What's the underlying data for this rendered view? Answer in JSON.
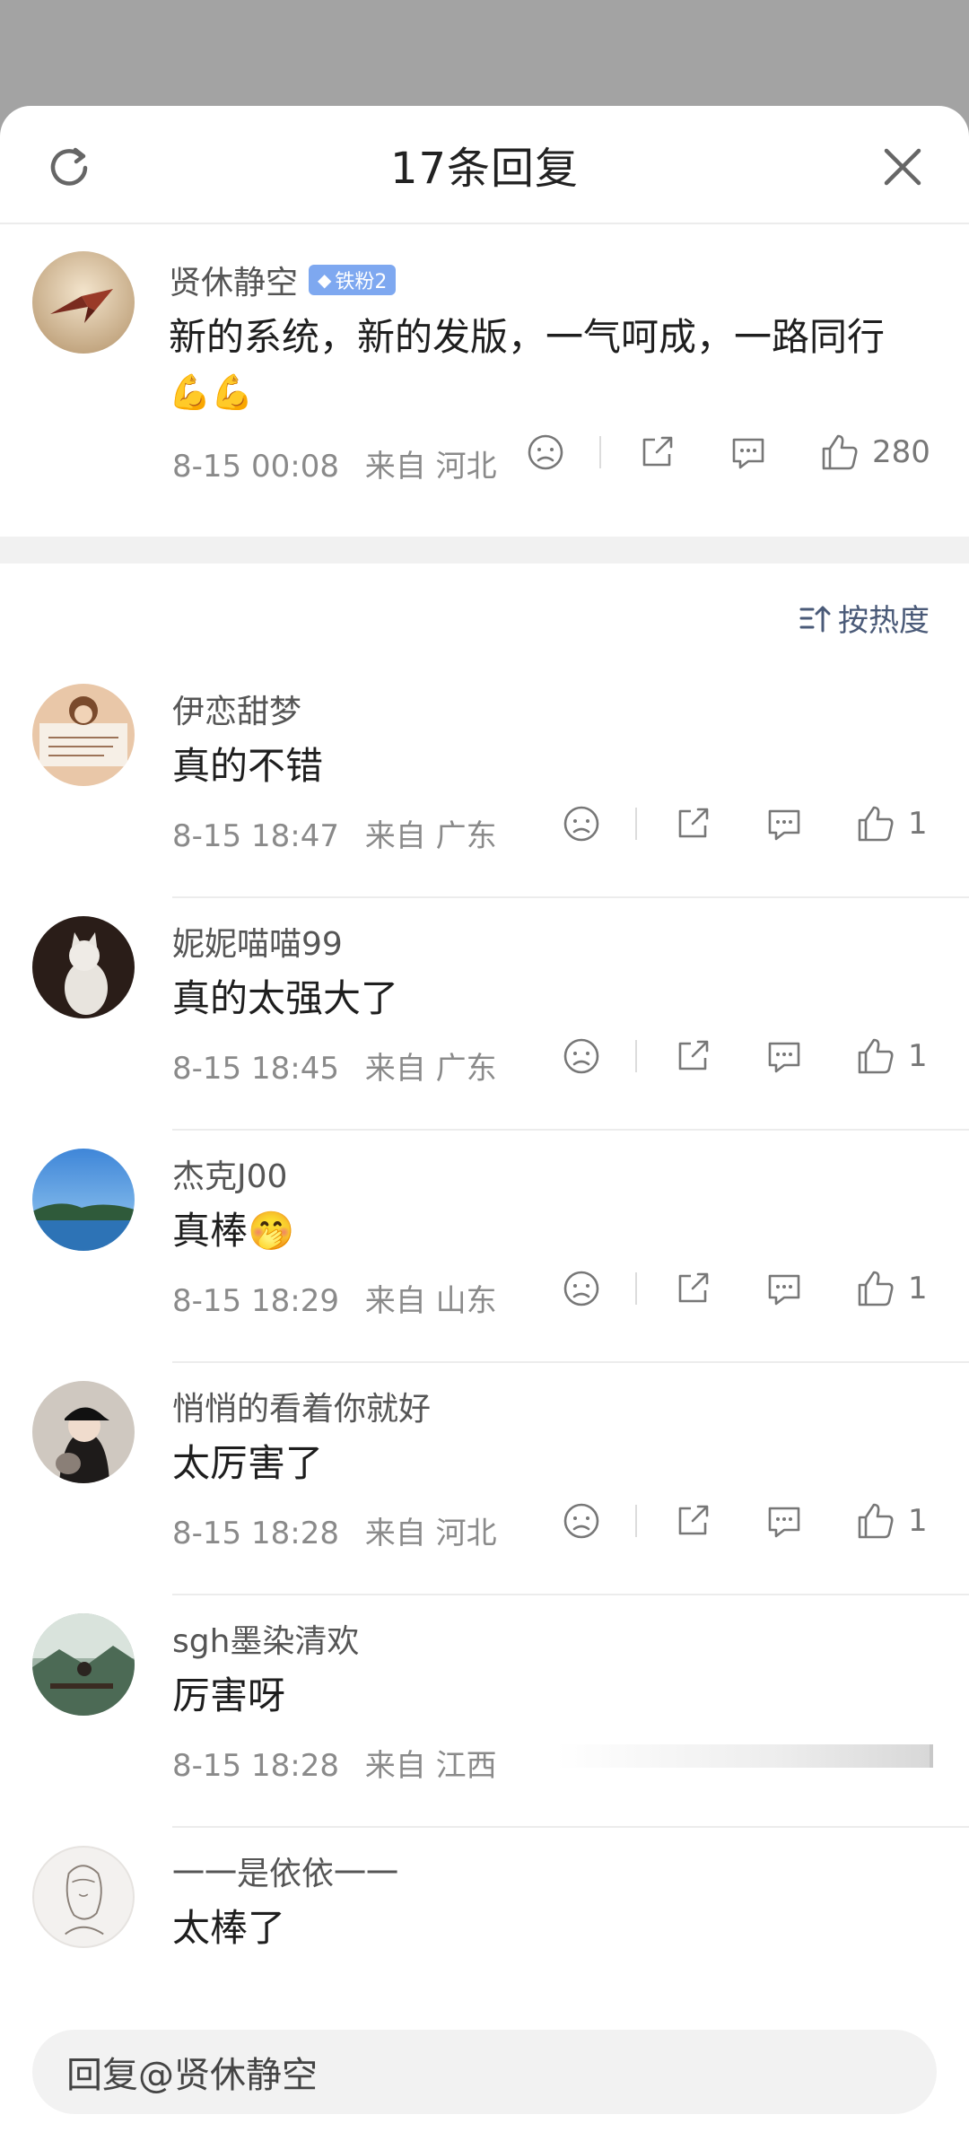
{
  "header": {
    "title": "17条回复"
  },
  "original": {
    "username": "贤休静空",
    "badge": "铁粉2",
    "text": "新的系统，新的发版，一气呵成，一路同行",
    "emoji": "💪💪",
    "date": "8-15 00:08",
    "location": "来自 河北",
    "likes": "280"
  },
  "sort": {
    "label": "按热度"
  },
  "replies": [
    {
      "username": "伊恋甜梦",
      "text": "真的不错",
      "date": "8-15 18:47",
      "location": "来自 广东",
      "likes": "1"
    },
    {
      "username": "妮妮喵喵99",
      "text": "真的太强大了",
      "date": "8-15 18:45",
      "location": "来自 广东",
      "likes": "1"
    },
    {
      "username": "杰克J00",
      "text": "真棒🤭",
      "date": "8-15 18:29",
      "location": "来自 山东",
      "likes": "1"
    },
    {
      "username": "悄悄的看着你就好",
      "text": "太厉害了",
      "date": "8-15 18:28",
      "location": "来自 河北",
      "likes": "1"
    },
    {
      "username": "sgh墨染清欢",
      "text": "厉害呀",
      "date": "8-15 18:28",
      "location": "来自 江西",
      "likes": ""
    },
    {
      "username": "一一是依依一一",
      "text": "太棒了",
      "date": "",
      "location": "",
      "likes": ""
    }
  ],
  "reply_input": {
    "placeholder": "回复@贤休静空"
  }
}
